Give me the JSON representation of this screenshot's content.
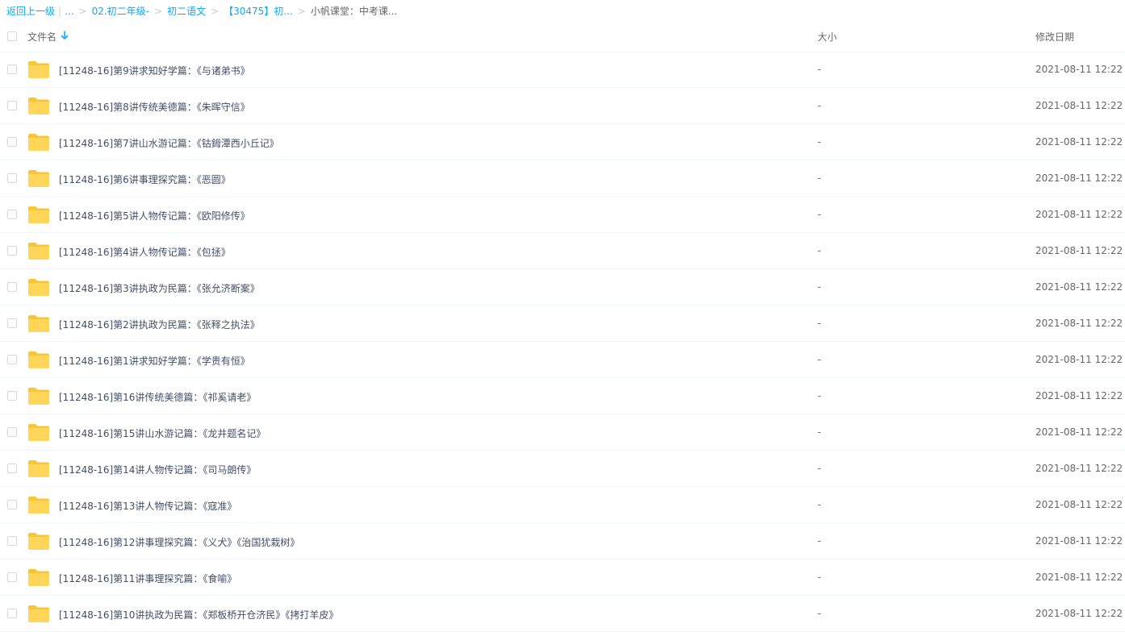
{
  "breadcrumb": {
    "back": "返回上一级",
    "ellipsis": "...",
    "items": [
      "02.初二年级-",
      "初二语文",
      "【30475】初..."
    ],
    "current": "小帆课堂：中考课..."
  },
  "header": {
    "name": "文件名",
    "size": "大小",
    "date": "修改日期"
  },
  "files": [
    {
      "name": "[11248-16]第9讲求知好学篇：《与诸弟书》",
      "size": "-",
      "date": "2021-08-11 12:22"
    },
    {
      "name": "[11248-16]第8讲传统美德篇：《朱晖守信》",
      "size": "-",
      "date": "2021-08-11 12:22"
    },
    {
      "name": "[11248-16]第7讲山水游记篇：《钴鉧潭西小丘记》",
      "size": "-",
      "date": "2021-08-11 12:22"
    },
    {
      "name": "[11248-16]第6讲事理探究篇：《恶圆》",
      "size": "-",
      "date": "2021-08-11 12:22"
    },
    {
      "name": "[11248-16]第5讲人物传记篇：《欧阳修传》",
      "size": "-",
      "date": "2021-08-11 12:22"
    },
    {
      "name": "[11248-16]第4讲人物传记篇：《包拯》",
      "size": "-",
      "date": "2021-08-11 12:22"
    },
    {
      "name": "[11248-16]第3讲执政为民篇：《张允济断案》",
      "size": "-",
      "date": "2021-08-11 12:22"
    },
    {
      "name": "[11248-16]第2讲执政为民篇：《张释之执法》",
      "size": "-",
      "date": "2021-08-11 12:22"
    },
    {
      "name": "[11248-16]第1讲求知好学篇：《学贵有恒》",
      "size": "-",
      "date": "2021-08-11 12:22"
    },
    {
      "name": "[11248-16]第16讲传统美德篇：《祁奚请老》",
      "size": "-",
      "date": "2021-08-11 12:22"
    },
    {
      "name": "[11248-16]第15讲山水游记篇：《龙井题名记》",
      "size": "-",
      "date": "2021-08-11 12:22"
    },
    {
      "name": "[11248-16]第14讲人物传记篇：《司马朗传》",
      "size": "-",
      "date": "2021-08-11 12:22"
    },
    {
      "name": "[11248-16]第13讲人物传记篇：《寇准》",
      "size": "-",
      "date": "2021-08-11 12:22"
    },
    {
      "name": "[11248-16]第12讲事理探究篇：《义犬》《治国犹栽树》",
      "size": "-",
      "date": "2021-08-11 12:22"
    },
    {
      "name": "[11248-16]第11讲事理探究篇：《食喻》",
      "size": "-",
      "date": "2021-08-11 12:22"
    },
    {
      "name": "[11248-16]第10讲执政为民篇：《郑板桥开仓济民》《拷打羊皮》",
      "size": "-",
      "date": "2021-08-11 12:22"
    }
  ],
  "colors": {
    "accent": "#09aaff",
    "folder": "#ffd659",
    "folder_tab": "#f8c632"
  },
  "icons": {
    "sort": "arrow-down-icon",
    "folder": "folder-icon",
    "checkbox": "checkbox-icon"
  }
}
